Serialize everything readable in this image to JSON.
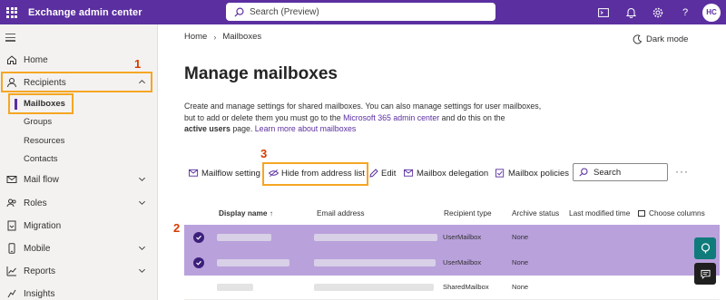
{
  "app": {
    "title": "Exchange admin center",
    "search_placeholder": "Search (Preview)",
    "avatar_initials": "HC"
  },
  "sidebar": {
    "items": [
      {
        "label": "Home"
      },
      {
        "label": "Recipients"
      },
      {
        "label": "Mail flow"
      },
      {
        "label": "Roles"
      },
      {
        "label": "Migration"
      },
      {
        "label": "Mobile"
      },
      {
        "label": "Reports"
      },
      {
        "label": "Insights"
      }
    ],
    "recipients_sub": [
      {
        "label": "Mailboxes"
      },
      {
        "label": "Groups"
      },
      {
        "label": "Resources"
      },
      {
        "label": "Contacts"
      }
    ]
  },
  "breadcrumb": {
    "home": "Home",
    "current": "Mailboxes"
  },
  "dark_mode_label": "Dark mode",
  "page_title": "Manage mailboxes",
  "description": {
    "line1": "Create and manage settings for shared mailboxes. You can also manage settings for user mailboxes,",
    "line2_pre": "but to add or delete them you must go to the ",
    "line2_link": "Microsoft 365 admin center",
    "line2_post": " and do this on the",
    "line3_bold": "active users",
    "line3_mid": " page. ",
    "line3_link": "Learn more about mailboxes"
  },
  "commands": {
    "mailflow": "Mailflow setting",
    "hide": "Hide from address list",
    "edit": "Edit",
    "delegation": "Mailbox delegation",
    "policies": "Mailbox policies",
    "search": "Search",
    "more": "···"
  },
  "callouts": {
    "one": "1",
    "two": "2",
    "three": "3"
  },
  "table": {
    "columns": [
      "Display name",
      "Email address",
      "Recipient type",
      "Archive status",
      "Last modified time",
      "Choose columns"
    ],
    "rows": [
      {
        "recipient_type": "UserMailbox",
        "archive_status": "None",
        "selected": true
      },
      {
        "recipient_type": "UserMailbox",
        "archive_status": "None",
        "selected": true
      },
      {
        "recipient_type": "SharedMailbox",
        "archive_status": "None",
        "selected": false
      }
    ]
  },
  "colors": {
    "brand": "#5b2fa0",
    "highlight": "#f5a623",
    "callout": "#d83b01",
    "selected_row": "#b9a1dc",
    "float_green": "#0f7b7b"
  }
}
